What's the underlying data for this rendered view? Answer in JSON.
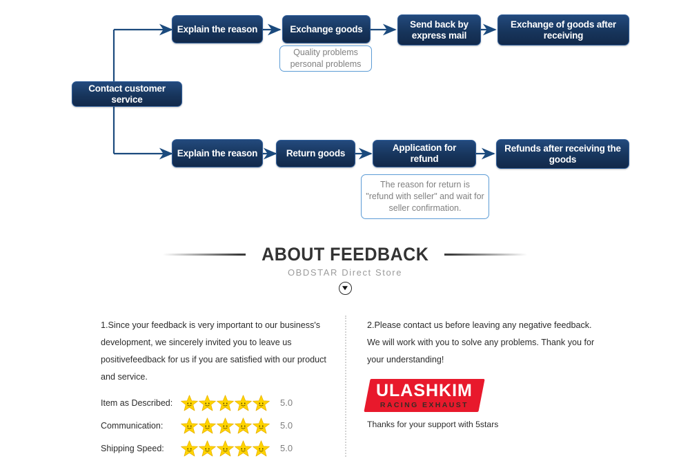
{
  "flowchart": {
    "root": {
      "label": "Contact customer service"
    },
    "exchange_branch": {
      "steps": [
        {
          "label": "Explain the reason"
        },
        {
          "label": "Exchange goods"
        },
        {
          "label": "Send back by express mail"
        },
        {
          "label": "Exchange of goods after receiving"
        }
      ],
      "note": "Quality problems\npersonal problems"
    },
    "refund_branch": {
      "steps": [
        {
          "label": "Explain the reason"
        },
        {
          "label": "Return goods"
        },
        {
          "label": "Application for refund"
        },
        {
          "label": "Refunds after receiving the goods"
        }
      ],
      "note": "The reason for return is \"refund with seller\" and wait for seller confirmation."
    },
    "colors": {
      "node_fill": "#1b3a66",
      "node_border": "#2f5d99",
      "connector": "#1b4a7d",
      "note_border": "#5b9bd5",
      "note_text": "#808080"
    }
  },
  "feedback": {
    "heading": {
      "title": "ABOUT FEEDBACK",
      "subtitle": "OBDSTAR Direct Store",
      "chevron_icon": "chevron-down-icon"
    },
    "left_paragraph": "1.Since your feedback is very important to our business's development, we sincerely invited you to leave us positivefeedback for us if you are satisfied with our product and service.",
    "right_paragraph": "2.Please contact us before leaving any negative feedback. We will work with you to solve any problems. Thank you for your understanding!",
    "ratings": [
      {
        "label": "Item as Described:",
        "stars": 5,
        "score": "5.0"
      },
      {
        "label": "Communication:",
        "stars": 5,
        "score": "5.0"
      },
      {
        "label": "Shipping Speed:",
        "stars": 5,
        "score": "5.0"
      }
    ],
    "star_color": "#ffd400",
    "logo": {
      "main": "ULASHKIM",
      "sub": "RACING EXHAUST",
      "background": "#e8192c",
      "caption": "Thanks for your support with 5stars"
    }
  }
}
